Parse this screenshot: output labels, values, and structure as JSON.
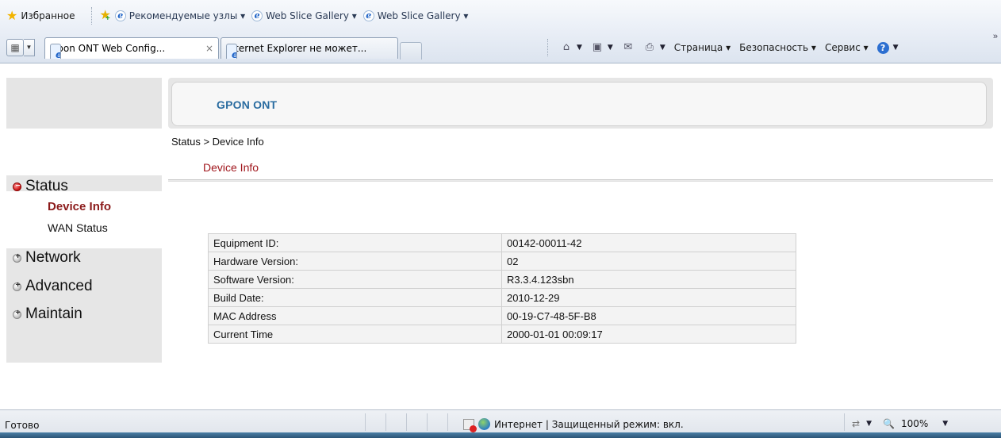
{
  "favorites_bar": {
    "favorites_label": "Избранное",
    "items": [
      {
        "label": "Рекомендуемые узлы ▾"
      },
      {
        "label": "Web Slice Gallery ▾"
      },
      {
        "label": "Web Slice Gallery ▾"
      }
    ]
  },
  "tabs": [
    {
      "title": "Gpon ONT Web Config...",
      "active": true,
      "close": "×"
    },
    {
      "title": "Internet Explorer не может...",
      "active": false
    }
  ],
  "command_bar": {
    "page_menu": "Страница ▾",
    "safety_menu": "Безопасность ▾",
    "tools_menu": "Сервис ▾",
    "chevron": "»"
  },
  "page": {
    "brand": "GPON ONT",
    "breadcrumb": "Status > Device Info",
    "section_title": "Device Info"
  },
  "sidebar": {
    "status": "Status",
    "status_sub": [
      "Device Info",
      "WAN Status"
    ],
    "network": "Network",
    "advanced": "Advanced",
    "maintain": "Maintain"
  },
  "device_info": {
    "rows": [
      {
        "label": "Equipment ID:",
        "value": "00142-00011-42"
      },
      {
        "label": "Hardware Version:",
        "value": "02"
      },
      {
        "label": "Software Version:",
        "value": "R3.3.4.123sbn"
      },
      {
        "label": "Build Date:",
        "value": "2010-12-29"
      },
      {
        "label": "MAC Address",
        "value": "00-19-C7-48-5F-B8"
      },
      {
        "label": "Current Time",
        "value": "2000-01-01 00:09:17"
      }
    ]
  },
  "status_bar": {
    "status": "Готово",
    "zone": "Интернет | Защищенный режим: вкл.",
    "zoom": "100%",
    "zoom_icon": "🔍"
  },
  "colors": {
    "brand": "#2a6ca0",
    "section_title": "#a0161c",
    "active_submenu": "#8b1a1a",
    "sidebar_bg": "#e6e6e6"
  }
}
